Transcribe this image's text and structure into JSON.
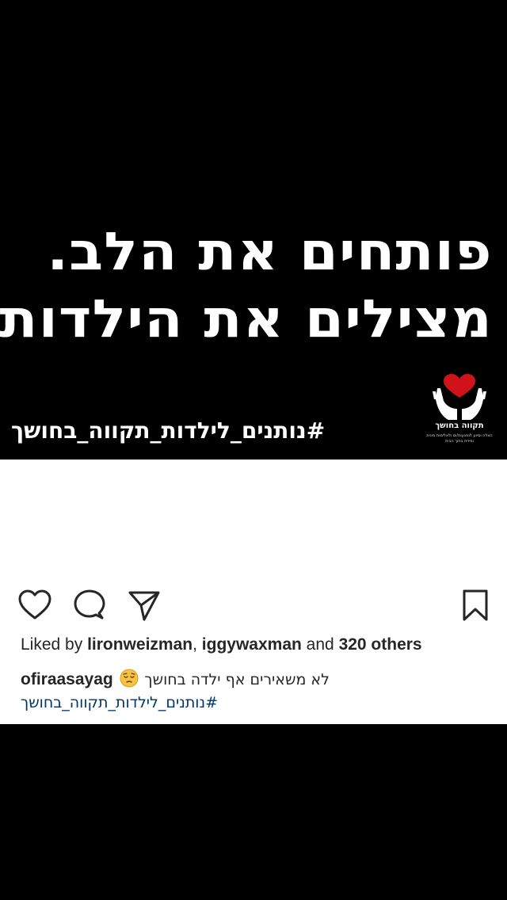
{
  "post_image": {
    "headline_line1": "פותחים את הלב.",
    "headline_line2": "מצילים את הילדות",
    "hashtag": "#נותנים_לילדות_תקווה_בחושך",
    "logo": {
      "icon": "heart-in-hands-icon",
      "name": "תקווה בחושך",
      "tagline": "הצלה וסיוע לנפגעות/ים ולאלימות מינית ופיזית בתוך הבית",
      "heart_color": "#d0121b"
    }
  },
  "actions": {
    "like": "heart-outline-icon",
    "comment": "comment-bubble-icon",
    "share": "paper-plane-icon",
    "save": "bookmark-icon"
  },
  "likes": {
    "prefix": "Liked by",
    "user1": "lironweizman",
    "separator": ",",
    "user2": "iggywaxman",
    "and_text": "and",
    "others": "320 others"
  },
  "caption": {
    "username": "ofiraasayag",
    "emoji": "😔",
    "text": "לא משאירים אף ילדה בחושך",
    "hashtag": "#נותנים_לילדות_תקווה_בחושך"
  },
  "colors": {
    "background": "#000000",
    "card": "#ffffff",
    "text": "#262626",
    "hashtag_link": "#003569"
  }
}
